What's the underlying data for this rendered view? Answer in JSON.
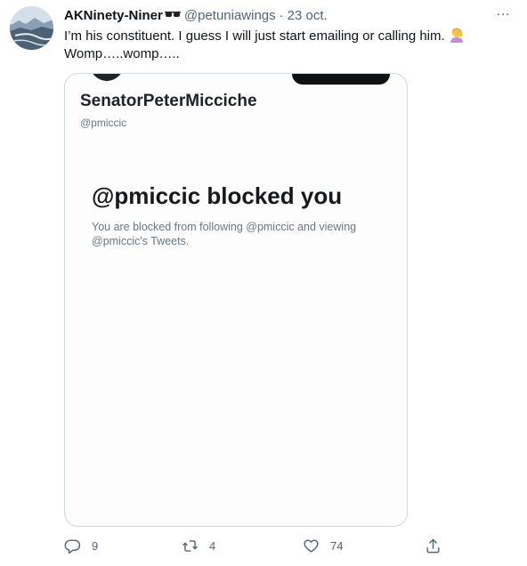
{
  "tweet": {
    "author": {
      "display_name": "AKNinety-Niner",
      "name_emoji_icon": "sunglasses-icon",
      "handle": "@petuniawings",
      "separator": "·",
      "date": "23 oct."
    },
    "text_line1": "I’m his constituent. I guess I will just start emailing or calling him.",
    "text_emoji_icon": "person-facepalming-icon",
    "text_line2": "Womp…..womp…..",
    "more_icon": "…",
    "media": {
      "screen_name": "SenatorPeterMicciche",
      "screen_handle": "@pmiccic",
      "blocked_title": "@pmiccic blocked you",
      "blocked_desc": "You are blocked from following @pmiccic and viewing @pmiccic's Tweets."
    },
    "actions": {
      "replies": "9",
      "retweets": "4",
      "likes": "74"
    }
  },
  "colors": {
    "text_primary": "#0f1419",
    "text_secondary": "#536471",
    "border": "#cfd9de"
  }
}
